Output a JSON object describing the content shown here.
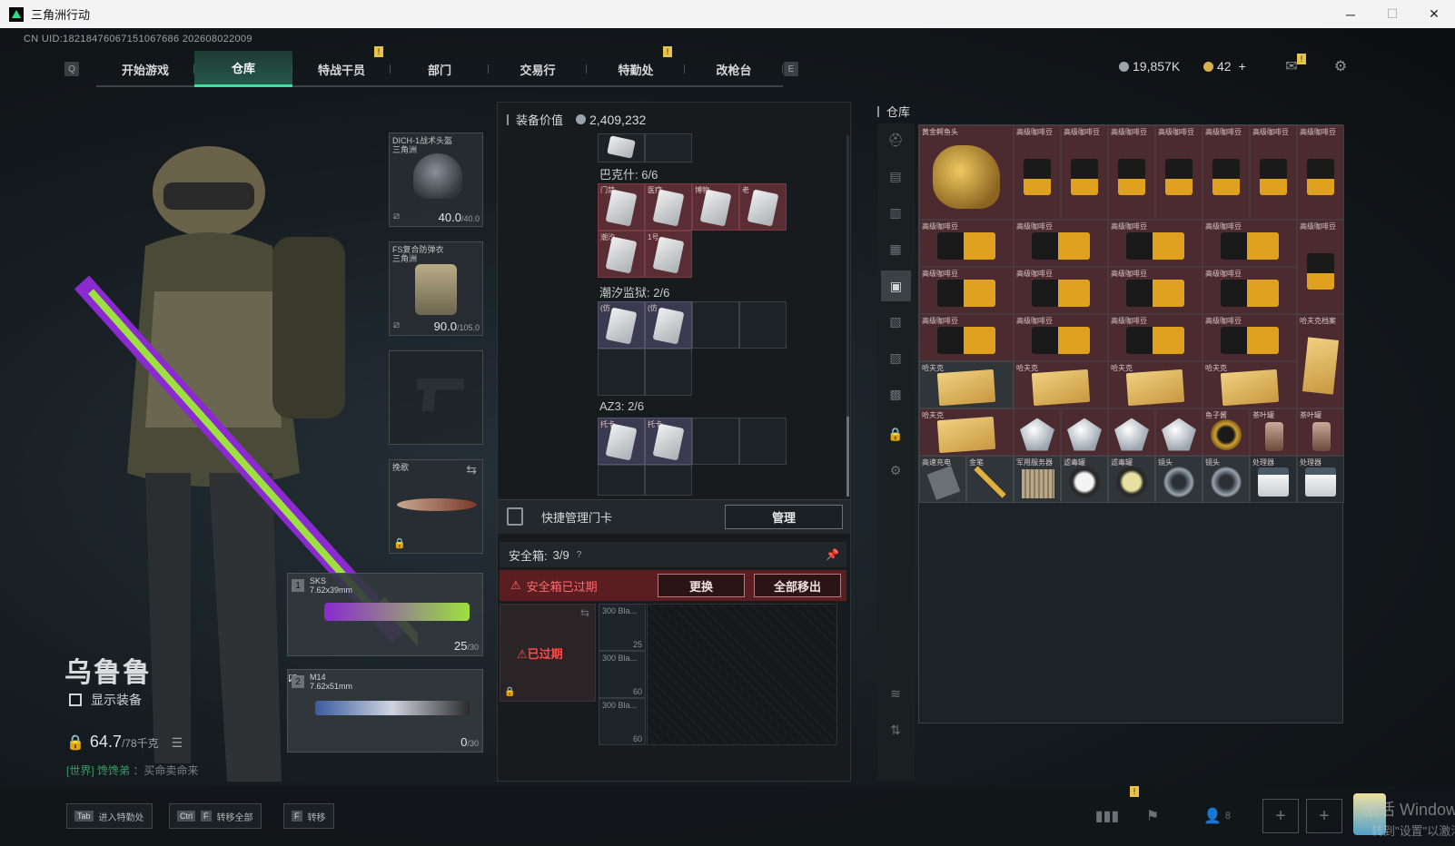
{
  "window": {
    "title": "三角洲行动",
    "min": "─",
    "max": "☐",
    "close": "✕"
  },
  "uid": "CN UID:18218476067151067686 202608022009",
  "nav": {
    "left_key": "Q",
    "right_key": "E",
    "tabs": [
      "开始游戏",
      "仓库",
      "特战干员",
      "部门",
      "交易行",
      "特勤处",
      "改枪台"
    ],
    "active": "仓库",
    "badge": "!"
  },
  "currency": {
    "silver": "19,857K",
    "gold": "42",
    "gold_add": "+",
    "silver_color": "#9aa4aa",
    "gold_color": "#d8b04a"
  },
  "character": {
    "name": "乌鲁鲁",
    "show_equipment": "显示装备",
    "weight": "64.7",
    "weight_max": "/78千克",
    "chat_channel": "[世界]",
    "chat_user": "馋馋弟",
    "chat_text": "：买命卖命来"
  },
  "equipment": {
    "helmet": {
      "label": "DICH-1战术头盔",
      "sub": "三角洲",
      "durability": "40.0",
      "max": "/40.0"
    },
    "armor": {
      "label": "FS复合防弹衣",
      "sub": "三角洲",
      "durability": "90.0",
      "max": "/105.0"
    },
    "melee": {
      "label": "挽歌"
    },
    "weapon1": {
      "num": "1",
      "name": "SKS",
      "caliber": "7.62x39mm",
      "ammo": "25",
      "max": "/30"
    },
    "weapon2": {
      "num": "2",
      "name": "M14",
      "caliber": "7.62x51mm",
      "ammo": "0",
      "max": "/30"
    }
  },
  "backpack": {
    "value_label": "装备价值",
    "value": "2,409,232",
    "sections": [
      {
        "title": "巴克什: 6/6",
        "tags": [
          "门禁",
          "医疗",
          "博物",
          "老",
          "潮汐",
          "1号"
        ]
      },
      {
        "title": "潮汐监狱: 2/6",
        "tags": [
          "(仿",
          "(仿"
        ]
      },
      {
        "title": "AZ3: 2/6",
        "tags": [
          "托卡",
          "托卡"
        ]
      }
    ],
    "quick_manage": "快捷管理门卡",
    "manage_btn": "管理",
    "safe_label": "安全箱:",
    "safe_count": "3/9",
    "safe_help": "?",
    "safe_expired_warn": "安全箱已过期",
    "replace_btn": "更换",
    "move_all_btn": "全部移出",
    "expired_box": "已过期",
    "ammo": [
      {
        "name": "300 Bla...",
        "count": "25"
      },
      {
        "name": "300 Bla...",
        "count": "60"
      },
      {
        "name": "300 Bla...",
        "count": "60"
      }
    ]
  },
  "stash": {
    "title": "仓库",
    "items": {
      "croc": "黄金鳄鱼头",
      "coffee": "高级咖啡豆",
      "file": "哈夫克档案",
      "hafuk": "哈夫克",
      "gem": "钻石",
      "caviar": "鱼子酱",
      "tea": "茶叶罐",
      "charger": "高速充电",
      "pen": "金笔",
      "chip": "军用服务器",
      "filter": "滤毒罐",
      "lens": "镜头",
      "device": "处理器"
    }
  },
  "bottom": {
    "hint_tab_key": "Tab",
    "hint_tab": "进入特勤处",
    "hint_ctrl_key": "Ctrl",
    "hint_f_key": "F",
    "hint_ctrl": "转移全部",
    "hint_f_key2": "F",
    "hint_f": "转移",
    "friends": "8",
    "activate_1": "激活 Windows",
    "activate_2": "转到\"设置\"以激活",
    "plus": "+"
  }
}
